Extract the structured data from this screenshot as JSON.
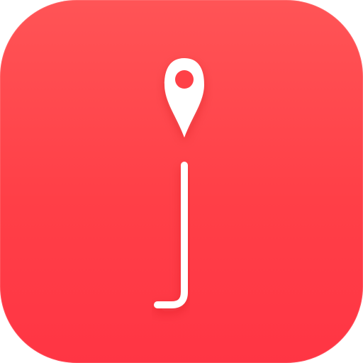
{
  "icon": {
    "name": "app-icon",
    "glyph_letter": "j",
    "colors": {
      "background_top": "#ff5456",
      "background_bottom": "#ff3544",
      "glyph": "#ffffff",
      "pin_dot": "#ff3f47"
    },
    "symbols": [
      "map-pin-icon",
      "letter-j-glyph"
    ]
  }
}
